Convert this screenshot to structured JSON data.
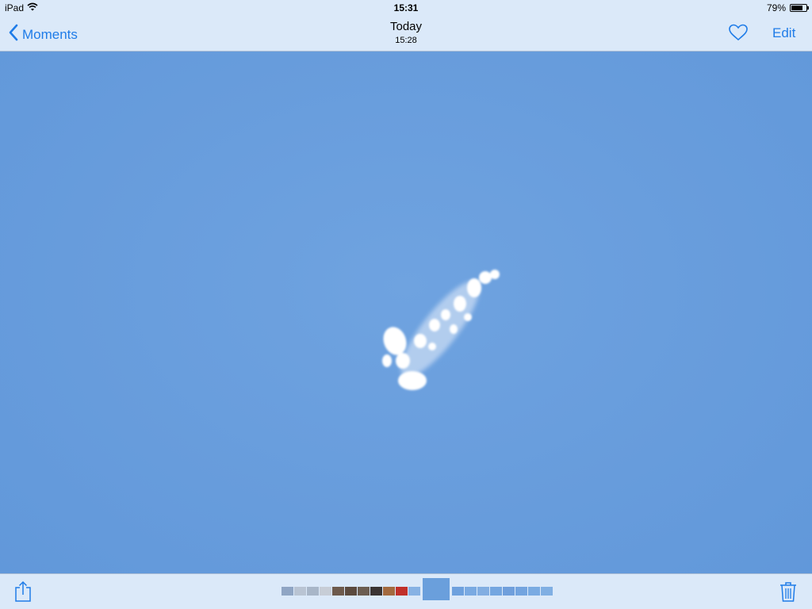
{
  "status_bar": {
    "device": "iPad",
    "time": "15:31",
    "battery": "79%",
    "battery_level": 0.79
  },
  "nav": {
    "back_label": "Moments",
    "title": "Today",
    "subtitle": "15:28",
    "edit_label": "Edit"
  },
  "colors": {
    "accent": "#1f7ce8",
    "bar_background": "#dbe9f9",
    "photo_sky": "#6a9fdc"
  },
  "icons": {
    "back": "chevron-left-icon",
    "favorite": "heart-icon",
    "share": "share-icon",
    "delete": "trash-icon",
    "wifi": "wifi-icon",
    "battery": "battery-icon"
  },
  "filmstrip": {
    "thumbs": [
      {
        "color": "#8fa5c4"
      },
      {
        "color": "#b9c4d3"
      },
      {
        "color": "#a8b6c8"
      },
      {
        "color": "#c7cdd6"
      },
      {
        "color": "#6d5a4c"
      },
      {
        "color": "#5b4a3e"
      },
      {
        "color": "#6b5d51"
      },
      {
        "color": "#3a3433"
      },
      {
        "color": "#a36a3f"
      },
      {
        "color": "#c0302a"
      },
      {
        "color": "#87b2e4"
      },
      {
        "color": "#6a9fdc",
        "selected": true
      },
      {
        "color": "#6ea1de"
      },
      {
        "color": "#7aaae2"
      },
      {
        "color": "#82aee2"
      },
      {
        "color": "#74a6e0"
      },
      {
        "color": "#6f9fdc"
      },
      {
        "color": "#73a4df"
      },
      {
        "color": "#7aabe2"
      },
      {
        "color": "#80afe3"
      }
    ]
  }
}
